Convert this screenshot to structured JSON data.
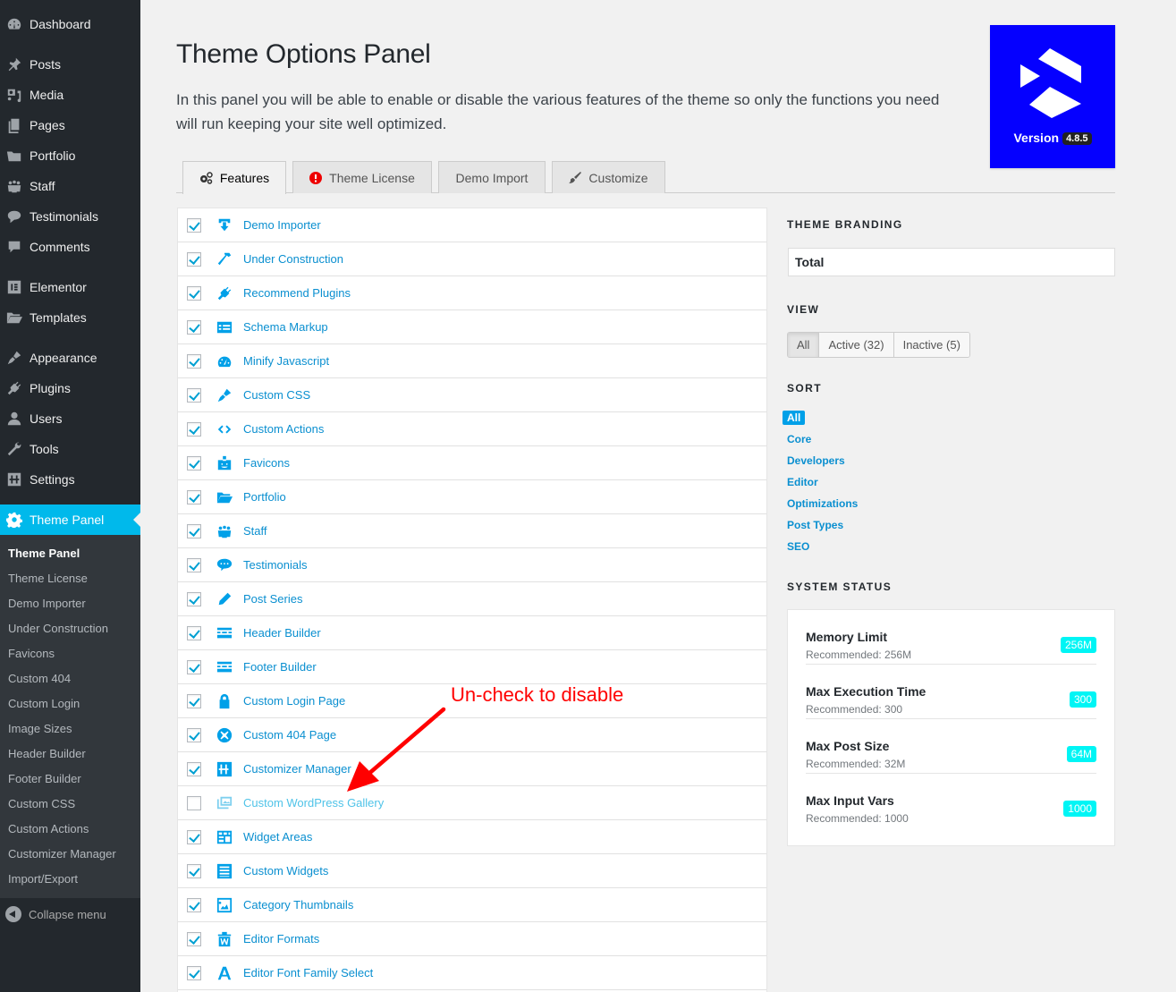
{
  "sidebar": {
    "items": [
      {
        "label": "Dashboard",
        "icon": "dashboard-icon"
      },
      {
        "label": "Posts",
        "icon": "pin-icon"
      },
      {
        "label": "Media",
        "icon": "media-icon"
      },
      {
        "label": "Pages",
        "icon": "pages-icon"
      },
      {
        "label": "Portfolio",
        "icon": "folder-icon"
      },
      {
        "label": "Staff",
        "icon": "group-icon"
      },
      {
        "label": "Testimonials",
        "icon": "speech-bubble-icon"
      },
      {
        "label": "Comments",
        "icon": "comment-icon"
      },
      {
        "label": "Elementor",
        "icon": "elementor-icon"
      },
      {
        "label": "Templates",
        "icon": "folder-open-icon"
      },
      {
        "label": "Appearance",
        "icon": "paintbrush-icon"
      },
      {
        "label": "Plugins",
        "icon": "plug-icon"
      },
      {
        "label": "Users",
        "icon": "user-icon"
      },
      {
        "label": "Tools",
        "icon": "wrench-icon"
      },
      {
        "label": "Settings",
        "icon": "sliders-icon"
      },
      {
        "label": "Theme Panel",
        "icon": "gear-icon"
      }
    ],
    "submenu": [
      "Theme Panel",
      "Theme License",
      "Demo Importer",
      "Under Construction",
      "Favicons",
      "Custom 404",
      "Custom Login",
      "Image Sizes",
      "Header Builder",
      "Footer Builder",
      "Custom CSS",
      "Custom Actions",
      "Customizer Manager",
      "Import/Export"
    ],
    "collapse_label": "Collapse menu"
  },
  "header": {
    "title": "Theme Options Panel",
    "description": "In this panel you will be able to enable or disable the various features of the theme so only the functions you need will run keeping your site well optimized."
  },
  "brand": {
    "version_label": "Version",
    "version": "4.8.5",
    "background": "#0500ff"
  },
  "tabs": [
    {
      "label": "Features",
      "icon": "gears-icon",
      "active": true
    },
    {
      "label": "Theme License",
      "icon": "alert-icon",
      "active": false
    },
    {
      "label": "Demo Import",
      "icon": "",
      "active": false
    },
    {
      "label": "Customize",
      "icon": "brush-icon",
      "active": false
    }
  ],
  "features": [
    {
      "label": "Demo Importer",
      "icon": "download-icon",
      "checked": true
    },
    {
      "label": "Under Construction",
      "icon": "hammer-icon",
      "checked": true
    },
    {
      "label": "Recommend Plugins",
      "icon": "plug-icon",
      "checked": true
    },
    {
      "label": "Schema Markup",
      "icon": "schema-icon",
      "checked": true
    },
    {
      "label": "Minify Javascript",
      "icon": "gauge-icon",
      "checked": true
    },
    {
      "label": "Custom CSS",
      "icon": "paintbrush-icon",
      "checked": true
    },
    {
      "label": "Custom Actions",
      "icon": "code-icon",
      "checked": true
    },
    {
      "label": "Favicons",
      "icon": "id-badge-icon",
      "checked": true
    },
    {
      "label": "Portfolio",
      "icon": "folder-open-icon",
      "checked": true
    },
    {
      "label": "Staff",
      "icon": "group-icon",
      "checked": true
    },
    {
      "label": "Testimonials",
      "icon": "speech-bubble-icon",
      "checked": true
    },
    {
      "label": "Post Series",
      "icon": "pencil-icon",
      "checked": true
    },
    {
      "label": "Header Builder",
      "icon": "header-layout-icon",
      "checked": true
    },
    {
      "label": "Footer Builder",
      "icon": "footer-layout-icon",
      "checked": true
    },
    {
      "label": "Custom Login Page",
      "icon": "lock-icon",
      "checked": true
    },
    {
      "label": "Custom 404 Page",
      "icon": "close-circle-icon",
      "checked": true
    },
    {
      "label": "Customizer Manager",
      "icon": "sliders-icon",
      "checked": true
    },
    {
      "label": "Custom WordPress Gallery",
      "icon": "gallery-icon",
      "checked": false
    },
    {
      "label": "Widget Areas",
      "icon": "widget-areas-icon",
      "checked": true
    },
    {
      "label": "Custom Widgets",
      "icon": "list-icon",
      "checked": true
    },
    {
      "label": "Category Thumbnails",
      "icon": "image-icon",
      "checked": true
    },
    {
      "label": "Editor Formats",
      "icon": "editor-formats-icon",
      "checked": true
    },
    {
      "label": "Editor Font Family Select",
      "icon": "font-icon",
      "checked": true
    }
  ],
  "side": {
    "branding_heading": "THEME BRANDING",
    "branding_value": "Total",
    "view_heading": "VIEW",
    "view_options": [
      "All",
      "Active (32)",
      "Inactive (5)"
    ],
    "sort_heading": "SORT",
    "sort_options": [
      "All",
      "Core",
      "Developers",
      "Editor",
      "Optimizations",
      "Post Types",
      "SEO"
    ],
    "status_heading": "SYSTEM STATUS",
    "status": [
      {
        "name": "Memory Limit",
        "recommended": "Recommended: 256M",
        "value": "256M"
      },
      {
        "name": "Max Execution Time",
        "recommended": "Recommended: 300",
        "value": "300"
      },
      {
        "name": "Max Post Size",
        "recommended": "Recommended: 32M",
        "value": "64M"
      },
      {
        "name": "Max Input Vars",
        "recommended": "Recommended: 1000",
        "value": "1000"
      }
    ]
  },
  "annotation": {
    "text": "Un-check to disable",
    "color": "#ff0000"
  },
  "colors": {
    "accent": "#00b9eb",
    "link": "#0a8fd0",
    "sidebar_bg": "#23282d",
    "badge": "#00f5f5"
  }
}
